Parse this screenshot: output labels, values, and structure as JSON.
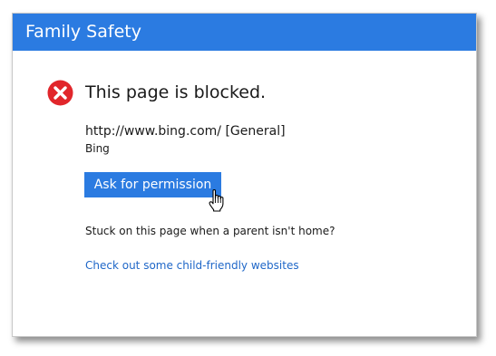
{
  "window": {
    "title": "Family Safety"
  },
  "block": {
    "icon": "error-x-icon",
    "icon_color": "#e1262b",
    "headline": "This page is blocked.",
    "url": "http://www.bing.com/ [General]",
    "site_name": "Bing"
  },
  "actions": {
    "ask_permission_label": "Ask for permission",
    "stuck_text": "Stuck on this page when a parent isn't home?",
    "child_friendly_link": "Check out some child-friendly websites"
  },
  "colors": {
    "accent": "#2b7be1",
    "link": "#1f67c8"
  }
}
